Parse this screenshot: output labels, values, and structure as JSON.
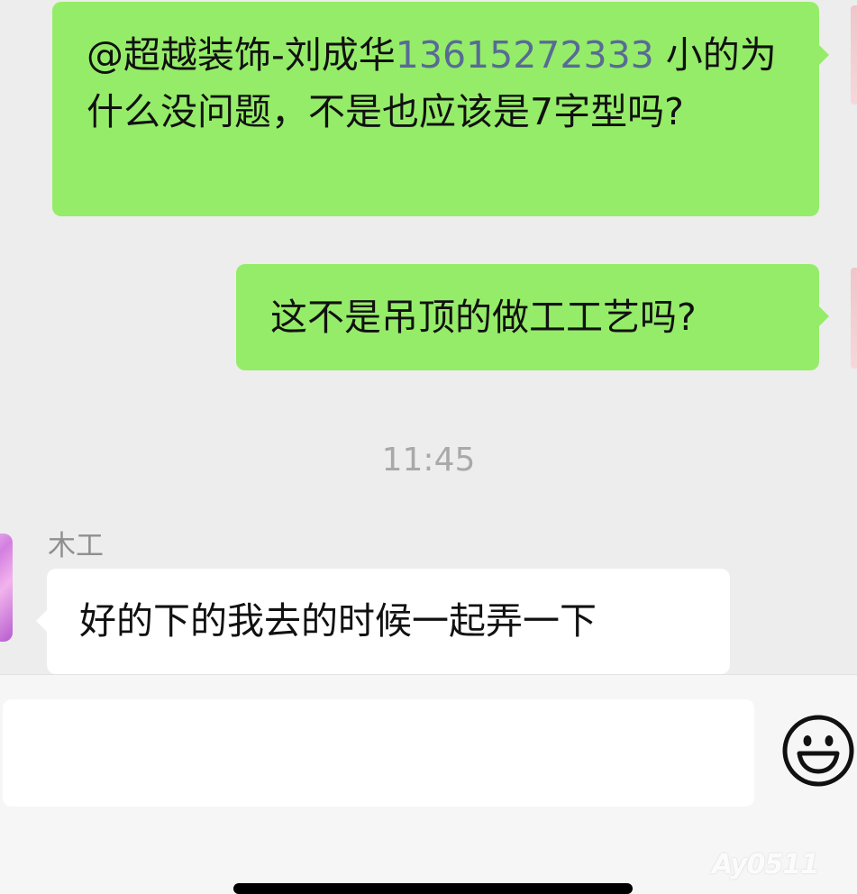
{
  "messages": {
    "msg1": {
      "mention": "@超越装饰-刘成华",
      "phone": "13615272333",
      "text": " 小的为什么没问题，不是也应该是7字型吗?"
    },
    "msg2": {
      "text": "这不是吊顶的做工工艺吗?"
    },
    "timestamp": "11:45",
    "msg3": {
      "sender": "木工",
      "text": "好的下的我去的时候一起弄一下"
    }
  },
  "input": {
    "value": "",
    "placeholder": ""
  },
  "icons": {
    "emoji": "smiley-face-icon"
  },
  "watermark": "Ay0511",
  "colors": {
    "outgoing_bubble": "#95ec69",
    "incoming_bubble": "#ffffff",
    "chat_background": "#ededed",
    "link": "#576b95"
  }
}
